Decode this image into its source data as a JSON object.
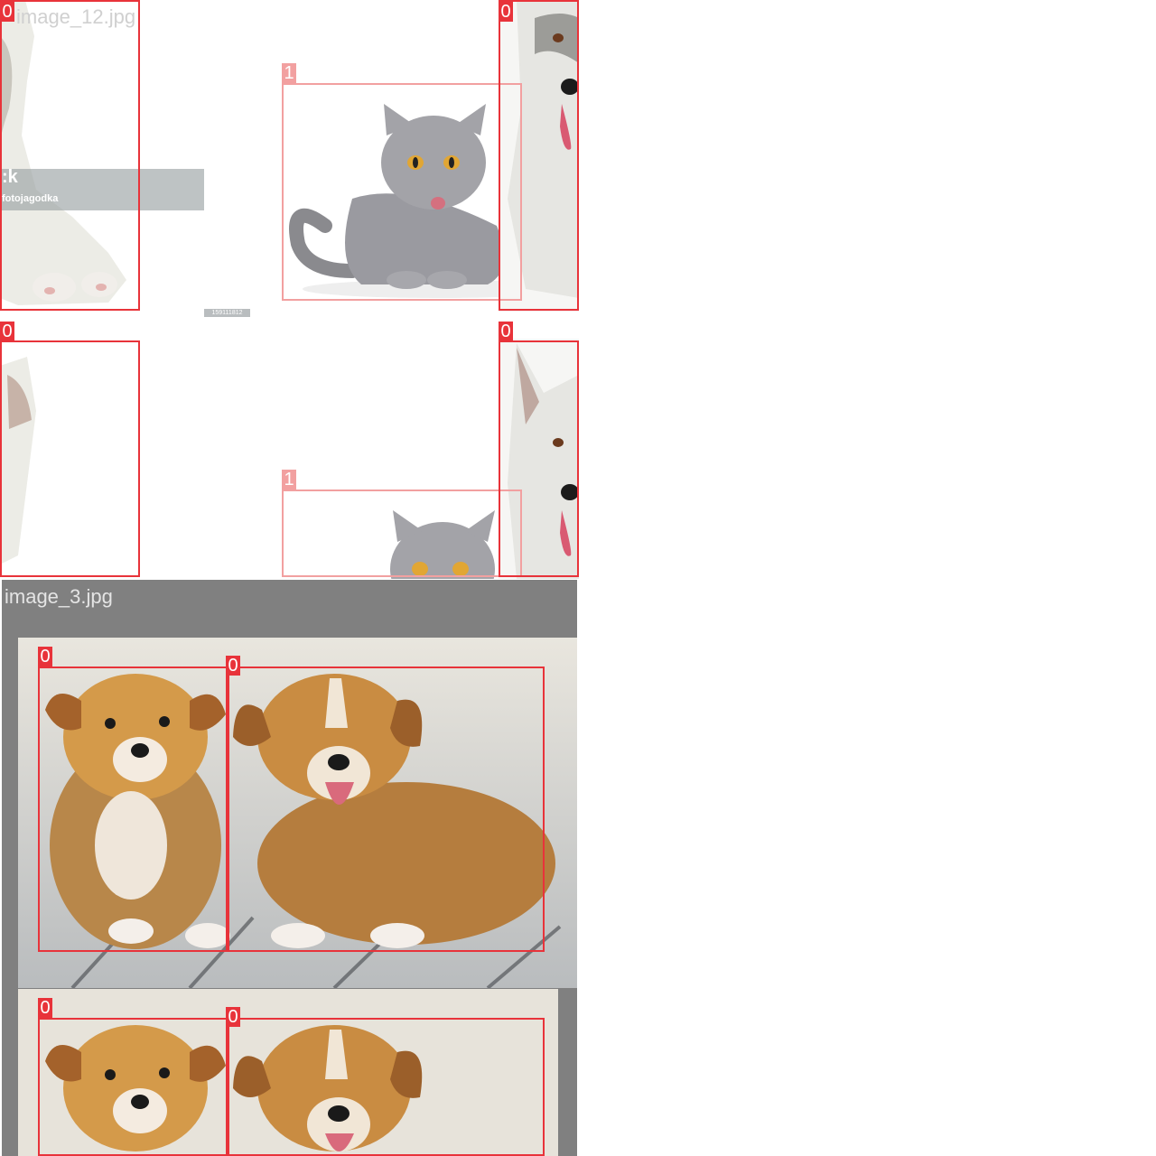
{
  "tiles": {
    "top": {
      "filename": "image_12.jpg"
    },
    "bottom": {
      "filename": "image_3.jpg"
    }
  },
  "watermark": {
    "title": ":k",
    "author": "fotojagodka",
    "image_id": "159111812"
  },
  "detections": {
    "dog_left_upper": "0",
    "dog_right_upper": "0",
    "cat_upper": "1",
    "dog_left_lower": "0",
    "dog_right_lower": "0",
    "cat_lower": "1",
    "puppy_a_upper": "0",
    "puppy_b_upper": "0",
    "puppy_a_lower": "0",
    "puppy_b_lower": "0"
  },
  "colors": {
    "class0_box": "#e8333a",
    "class1_box": "#f2a0a0",
    "mosaic_pad": "#808080"
  }
}
